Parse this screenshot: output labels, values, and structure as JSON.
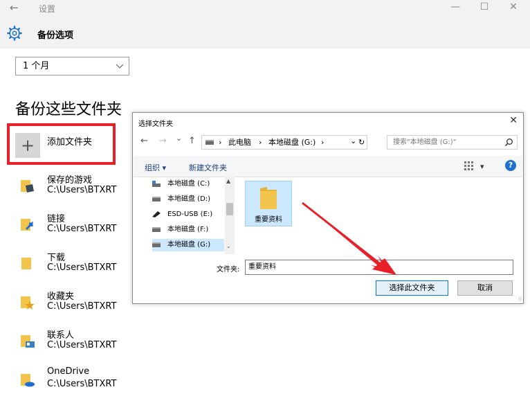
{
  "window": {
    "title": "设置",
    "back": "←",
    "minimize": "—",
    "maximize": "☐",
    "close": "✕"
  },
  "page": {
    "title": "备份选项"
  },
  "frequency": {
    "value": "1 个月"
  },
  "section": {
    "title": "备份这些文件夹"
  },
  "add_folder": {
    "plus": "+",
    "label": "添加文件夹"
  },
  "folders": [
    {
      "name": "保存的游戏",
      "path": "C:\\Users\\BTXRT",
      "icon": "saved-games-icon"
    },
    {
      "name": "链接",
      "path": "C:\\Users\\BTXRT",
      "icon": "links-icon"
    },
    {
      "name": "下载",
      "path": "C:\\Users\\BTXRT",
      "icon": "downloads-icon"
    },
    {
      "name": "收藏夹",
      "path": "C:\\Users\\BTXRT",
      "icon": "favorites-icon"
    },
    {
      "name": "联系人",
      "path": "C:\\Users\\BTXRT",
      "icon": "contacts-icon"
    },
    {
      "name": "OneDrive",
      "path": "C:\\Users\\BTXRT",
      "icon": "onedrive-icon"
    }
  ],
  "dialog": {
    "title": "选择文件夹",
    "close": "✕",
    "nav": {
      "back": "←",
      "forward": "→",
      "recent": "⌄",
      "up": "↑"
    },
    "address": {
      "root_sep": "›",
      "pc": "此电脑",
      "sep": "›",
      "drive": "本地磁盘 (G:)",
      "end_sep": "›",
      "dropdown": "⌄",
      "refresh": "↻"
    },
    "search_placeholder": "搜索\"本地磁盘 (G:)\"",
    "toolbar": {
      "organize": "组织 ▾",
      "new_folder": "新建文件夹",
      "view_dropdown": "▾",
      "help": "?"
    },
    "nav_items": [
      {
        "label": "本地磁盘 (C:)"
      },
      {
        "label": "本地磁盘 (D:)"
      },
      {
        "label": "ESD-USB (E:)"
      },
      {
        "label": "本地磁盘 (F:)"
      },
      {
        "label": "本地磁盘 (G:)"
      }
    ],
    "scroll": {
      "up": "▲",
      "down": "⌄"
    },
    "folder_tile": {
      "label": "重要资料"
    },
    "filename_label": "文件夹:",
    "filename_value": "重要资料",
    "ok": "选择此文件夹",
    "cancel": "取消",
    "grip": "⁞⁞"
  },
  "colors": {
    "highlight": "#e8202a",
    "arrow": "#e8202a",
    "folder": "#f3c44c",
    "accent": "#0078d7"
  }
}
